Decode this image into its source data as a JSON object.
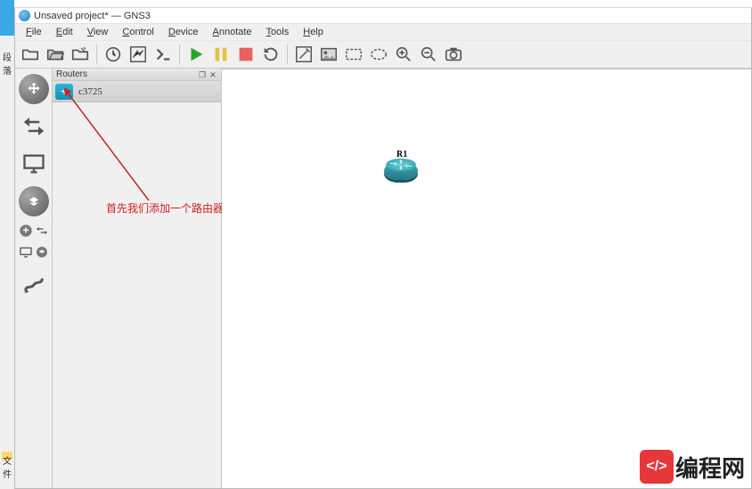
{
  "window": {
    "title": "Unsaved project* — GNS3"
  },
  "menu": {
    "file": "File",
    "edit": "Edit",
    "view": "View",
    "control": "Control",
    "device": "Device",
    "annotate": "Annotate",
    "tools": "Tools",
    "help": "Help"
  },
  "panel": {
    "title": "Routers",
    "dock_btn": "❐",
    "close_btn": "✕",
    "items": [
      {
        "label": "c3725"
      }
    ]
  },
  "canvas": {
    "nodes": [
      {
        "label": "R1"
      }
    ]
  },
  "annotation": {
    "text": "首先我们添加一个路由器设备"
  },
  "desktop_sliver": {
    "top_label": "段落",
    "bottom_label": "文件"
  },
  "watermark": {
    "badge": "</>",
    "text": "编程网"
  }
}
